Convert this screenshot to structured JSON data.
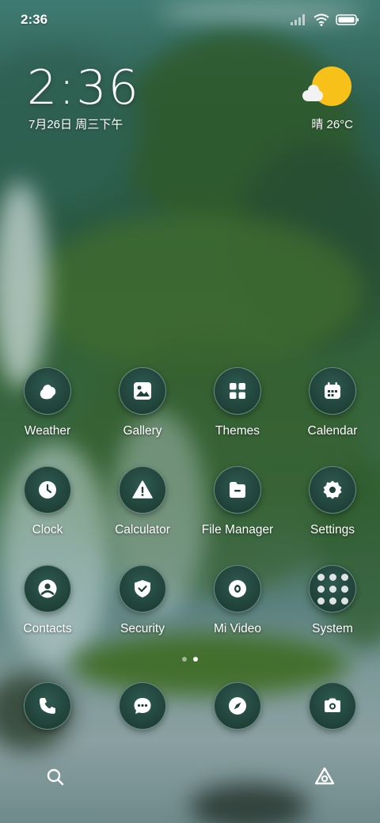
{
  "status_bar": {
    "time": "2:36",
    "icons": [
      "signal-icon",
      "wifi-icon",
      "battery-icon"
    ]
  },
  "clock_widget": {
    "time": "2:36",
    "date": "7月26日 周三下午"
  },
  "weather_widget": {
    "condition_temp": "晴 26°C",
    "icon": "sunny-cloud-icon"
  },
  "apps": [
    [
      {
        "label": "Weather",
        "icon": "weather-icon"
      },
      {
        "label": "Gallery",
        "icon": "gallery-icon"
      },
      {
        "label": "Themes",
        "icon": "themes-icon"
      },
      {
        "label": "Calendar",
        "icon": "calendar-icon"
      }
    ],
    [
      {
        "label": "Clock",
        "icon": "clock-icon"
      },
      {
        "label": "Calculator",
        "icon": "calculator-icon"
      },
      {
        "label": "File Manager",
        "icon": "file-manager-icon"
      },
      {
        "label": "Settings",
        "icon": "settings-icon"
      }
    ],
    [
      {
        "label": "Contacts",
        "icon": "contacts-icon"
      },
      {
        "label": "Security",
        "icon": "security-icon"
      },
      {
        "label": "Mi Video",
        "icon": "mi-video-icon"
      },
      {
        "label": "System",
        "icon": "system-folder-icon"
      }
    ]
  ],
  "page_indicator": {
    "pages": 2,
    "current": 2
  },
  "dock": [
    {
      "icon": "phone-icon"
    },
    {
      "icon": "messages-icon"
    },
    {
      "icon": "browser-icon"
    },
    {
      "icon": "camera-icon"
    }
  ],
  "bottom_bar": {
    "left_icon": "search-icon",
    "right_icon": "assistant-icon"
  },
  "colors": {
    "sun": "#f7c11a",
    "icon_bg": "#1f4138",
    "icon_border": "#a0c8be"
  }
}
